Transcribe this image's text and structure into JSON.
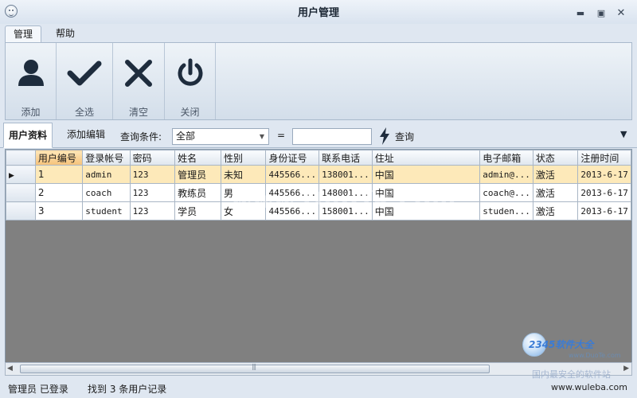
{
  "window": {
    "title": "用户管理"
  },
  "menu": {
    "tabs": [
      "管理",
      "帮助"
    ]
  },
  "ribbon": {
    "buttons": [
      {
        "label": "添加",
        "icon": "user-icon"
      },
      {
        "label": "全选",
        "icon": "checkmark-icon"
      },
      {
        "label": "清空",
        "icon": "x-icon"
      },
      {
        "label": "关闭",
        "icon": "power-icon"
      }
    ]
  },
  "subtabs": [
    "用户资料",
    "添加编辑"
  ],
  "query": {
    "label": "查询条件:",
    "select_value": "全部",
    "equals": "=",
    "input_value": "",
    "button_label": "查询"
  },
  "table": {
    "columns": [
      "用户编号",
      "登录帐号",
      "密码",
      "姓名",
      "性别",
      "身份证号",
      "联系电话",
      "住址",
      "电子邮箱",
      "状态",
      "注册时间"
    ],
    "rows": [
      [
        "1",
        "admin",
        "123",
        "管理员",
        "未知",
        "445566...",
        "138001...",
        "中国",
        "admin@...",
        "激活",
        "2013-6-17"
      ],
      [
        "2",
        "coach",
        "123",
        "教练员",
        "男",
        "445566...",
        "148001...",
        "中国",
        "coach@...",
        "激活",
        "2013-6-17"
      ],
      [
        "3",
        "student",
        "123",
        "学员",
        "女",
        "445566...",
        "158001...",
        "中国",
        "studen...",
        "激活",
        "2013-6-17"
      ]
    ],
    "selected_row": 0
  },
  "status": {
    "user": "管理员 已登录",
    "count": "找到 3 条用户记录"
  },
  "watermark": {
    "center": "www.DuoTe.com",
    "site": "2345软件大全",
    "site_sub": "www.DuoTe.com",
    "slogan": "国内最安全的软件站",
    "url": "www.wuleba.com"
  },
  "colors": {
    "selected_row": "#fde9b9",
    "sorted_header": "#f5c27a",
    "grid_background": "#808080"
  }
}
